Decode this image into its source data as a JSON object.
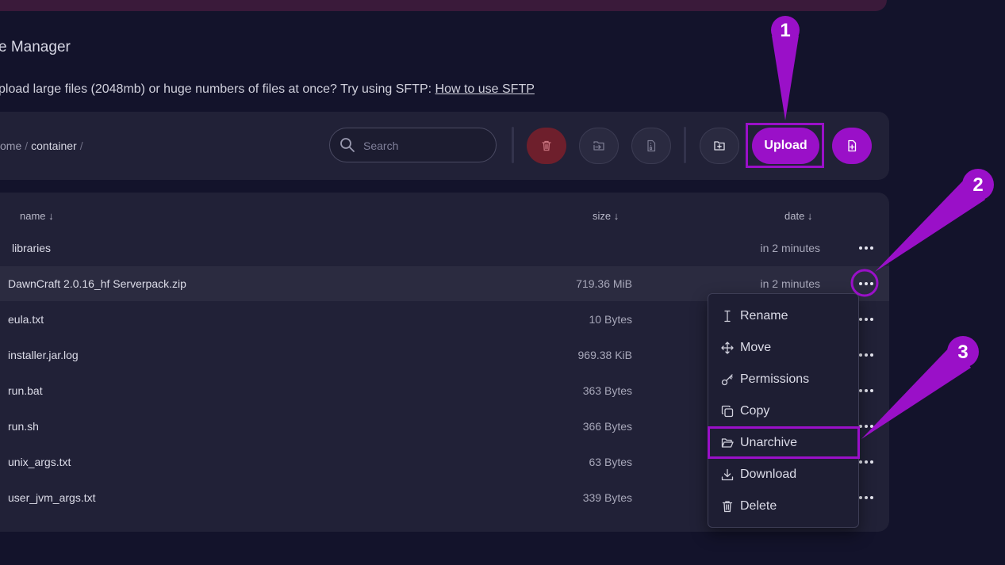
{
  "page": {
    "title": "e Manager",
    "sftp_text": "pload large files (2048mb) or huge numbers of files at once? Try using SFTP:",
    "sftp_link": "How to use SFTP"
  },
  "breadcrumb": {
    "prefix": "ome",
    "current": "container",
    "sep": "/"
  },
  "search": {
    "placeholder": "Search"
  },
  "toolbar": {
    "upload_label": "Upload",
    "icons": [
      "trash-icon",
      "move-icon",
      "archive-icon",
      "new-folder-icon",
      "new-file-icon"
    ]
  },
  "table": {
    "headers": {
      "name": "name ↓",
      "size": "size ↓",
      "date": "date ↓"
    },
    "rows": [
      {
        "name": "libraries",
        "size": "",
        "date": "in 2 minutes"
      },
      {
        "name": "DawnCraft 2.0.16_hf Serverpack.zip",
        "size": "719.36 MiB",
        "date": "in 2 minutes",
        "selected": true
      },
      {
        "name": "eula.txt",
        "size": "10 Bytes",
        "date": ""
      },
      {
        "name": "installer.jar.log",
        "size": "969.38 KiB",
        "date": ""
      },
      {
        "name": "run.bat",
        "size": "363 Bytes",
        "date": ""
      },
      {
        "name": "run.sh",
        "size": "366 Bytes",
        "date": ""
      },
      {
        "name": "unix_args.txt",
        "size": "63 Bytes",
        "date": ""
      },
      {
        "name": "user_jvm_args.txt",
        "size": "339 Bytes",
        "date": ""
      }
    ]
  },
  "context_menu": {
    "items": [
      {
        "label": "Rename",
        "icon": "cursor-text-icon"
      },
      {
        "label": "Move",
        "icon": "move-arrows-icon"
      },
      {
        "label": "Permissions",
        "icon": "key-icon"
      },
      {
        "label": "Copy",
        "icon": "copy-icon"
      },
      {
        "label": "Unarchive",
        "icon": "folder-open-icon"
      },
      {
        "label": "Download",
        "icon": "download-icon"
      },
      {
        "label": "Delete",
        "icon": "trash-icon"
      }
    ]
  },
  "callouts": [
    "1",
    "2",
    "3"
  ],
  "colors": {
    "accent": "#9a10c8",
    "background": "#13132b",
    "panel": "#212137",
    "danger": "#6e1f2c"
  }
}
